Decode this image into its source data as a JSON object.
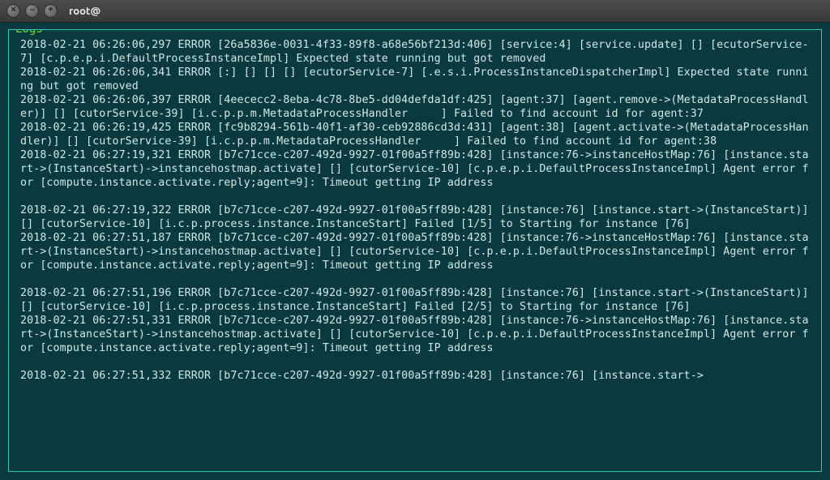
{
  "titlebar": {
    "close_glyph": "×",
    "minimize_glyph": "–",
    "maximize_glyph": "+",
    "title": "root@"
  },
  "panel": {
    "label": "Logs"
  },
  "log_lines": [
    "2018-02-21 06:26:06,297 ERROR [26a5836e-0031-4f33-89f8-a68e56bf213d:406] [service:4] [service.update] [] [ecutorService-7] [c.p.e.p.i.DefaultProcessInstanceImpl] Expected state running but got removed",
    "2018-02-21 06:26:06,341 ERROR [:] [] [] [] [ecutorService-7] [.e.s.i.ProcessInstanceDispatcherImpl] Expected state running but got removed",
    "2018-02-21 06:26:06,397 ERROR [4eececc2-8eba-4c78-8be5-dd04defda1df:425] [agent:37] [agent.remove->(MetadataProcessHandler)] [] [cutorService-39] [i.c.p.p.m.MetadataProcessHandler     ] Failed to find account id for agent:37",
    "2018-02-21 06:26:19,425 ERROR [fc9b8294-561b-40f1-af30-ceb92886cd3d:431] [agent:38] [agent.activate->(MetadataProcessHandler)] [] [cutorService-39] [i.c.p.p.m.MetadataProcessHandler     ] Failed to find account id for agent:38",
    "2018-02-21 06:27:19,321 ERROR [b7c71cce-c207-492d-9927-01f00a5ff89b:428] [instance:76->instanceHostMap:76] [instance.start->(InstanceStart)->instancehostmap.activate] [] [cutorService-10] [c.p.e.p.i.DefaultProcessInstanceImpl] Agent error for [compute.instance.activate.reply;agent=9]: Timeout getting IP address",
    "",
    "2018-02-21 06:27:19,322 ERROR [b7c71cce-c207-492d-9927-01f00a5ff89b:428] [instance:76] [instance.start->(InstanceStart)] [] [cutorService-10] [i.c.p.process.instance.InstanceStart] Failed [1/5] to Starting for instance [76]",
    "2018-02-21 06:27:51,187 ERROR [b7c71cce-c207-492d-9927-01f00a5ff89b:428] [instance:76->instanceHostMap:76] [instance.start->(InstanceStart)->instancehostmap.activate] [] [cutorService-10] [c.p.e.p.i.DefaultProcessInstanceImpl] Agent error for [compute.instance.activate.reply;agent=9]: Timeout getting IP address",
    "",
    "2018-02-21 06:27:51,196 ERROR [b7c71cce-c207-492d-9927-01f00a5ff89b:428] [instance:76] [instance.start->(InstanceStart)] [] [cutorService-10] [i.c.p.process.instance.InstanceStart] Failed [2/5] to Starting for instance [76]",
    "2018-02-21 06:27:51,331 ERROR [b7c71cce-c207-492d-9927-01f00a5ff89b:428] [instance:76->instanceHostMap:76] [instance.start->(InstanceStart)->instancehostmap.activate] [] [cutorService-10] [c.p.e.p.i.DefaultProcessInstanceImpl] Agent error for [compute.instance.activate.reply;agent=9]: Timeout getting IP address",
    "",
    "2018-02-21 06:27:51,332 ERROR [b7c71cce-c207-492d-9927-01f00a5ff89b:428] [instance:76] [instance.start->"
  ]
}
